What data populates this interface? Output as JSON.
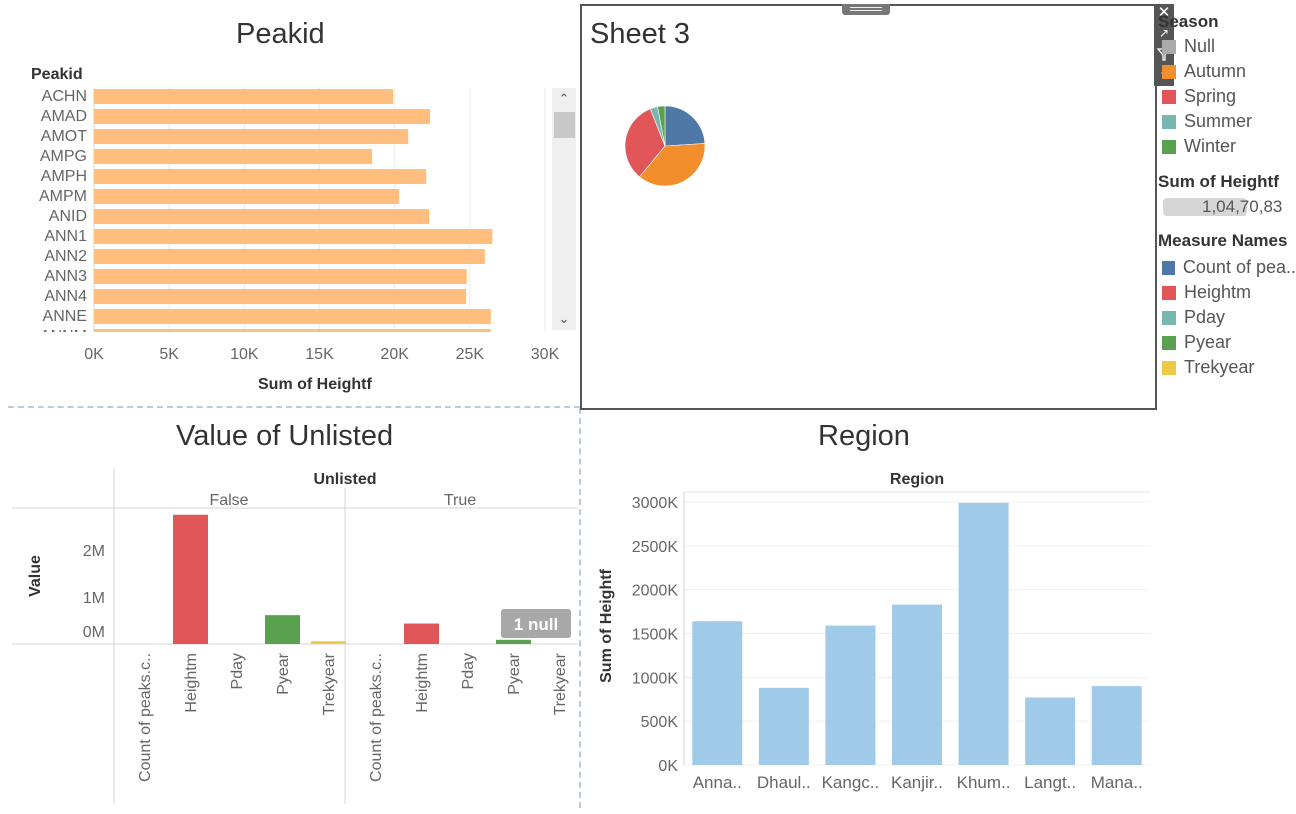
{
  "sheets": {
    "peakid": {
      "title": "Peakid"
    },
    "sheet3": {
      "title": "Sheet 3"
    },
    "unlisted": {
      "title": "Value of Unlisted"
    },
    "region": {
      "title": "Region"
    }
  },
  "legends": {
    "season": {
      "title": "Season",
      "items": [
        {
          "label": "Null",
          "color": "#aaaaaa"
        },
        {
          "label": "Autumn",
          "color": "#f28e2b"
        },
        {
          "label": "Spring",
          "color": "#e15759"
        },
        {
          "label": "Summer",
          "color": "#76b7b2"
        },
        {
          "label": "Winter",
          "color": "#59a14f"
        }
      ]
    },
    "size": {
      "title": "Sum of Heightf",
      "value": "1,04,70,83"
    },
    "measures": {
      "title": "Measure Names",
      "items": [
        {
          "label": "Count of pea..",
          "color": "#4e79a7"
        },
        {
          "label": "Heightm",
          "color": "#e15759"
        },
        {
          "label": "Pday",
          "color": "#76b7b2"
        },
        {
          "label": "Pyear",
          "color": "#59a14f"
        },
        {
          "label": "Trekyear",
          "color": "#edc948"
        }
      ]
    }
  },
  "null_badge": "1 null",
  "chart_data": [
    {
      "type": "bar",
      "orientation": "horizontal",
      "title": "Peakid",
      "row_header": "Peakid",
      "xlabel": "Sum of Heightf",
      "categories": [
        "ACHN",
        "AMAD",
        "AMOT",
        "AMPG",
        "AMPH",
        "AMPM",
        "ANID",
        "ANN1",
        "ANN2",
        "ANN3",
        "ANN4",
        "ANNE"
      ],
      "values": [
        19900,
        22350,
        20900,
        18500,
        22100,
        20300,
        22300,
        26500,
        26000,
        24800,
        24750,
        26400
      ],
      "xlim": [
        0,
        30000
      ],
      "xticks": [
        "0K",
        "5K",
        "10K",
        "15K",
        "20K",
        "25K",
        "30K"
      ],
      "color": "#ffbe7d"
    },
    {
      "type": "pie",
      "title": "Sheet 3",
      "slices": [
        {
          "label": "Count of pea..",
          "value": 24,
          "color": "#4e79a7"
        },
        {
          "label": "Autumn",
          "value": 37,
          "color": "#f28e2b"
        },
        {
          "label": "Spring",
          "value": 33,
          "color": "#e15759"
        },
        {
          "label": "Summer",
          "value": 3,
          "color": "#76b7b2"
        },
        {
          "label": "Winter",
          "value": 3,
          "color": "#59a14f"
        }
      ]
    },
    {
      "type": "bar",
      "title": "Value of Unlisted",
      "column_header": "Unlisted",
      "ylabel": "Value",
      "panels": [
        {
          "name": "False",
          "categories": [
            "Count of peaks.c..",
            "Heightm",
            "Pday",
            "Pyear",
            "Trekyear"
          ],
          "values": [
            0,
            2780000,
            0,
            620000,
            60000
          ]
        },
        {
          "name": "True",
          "categories": [
            "Count of peaks.c..",
            "Heightm",
            "Pday",
            "Pyear",
            "Trekyear"
          ],
          "values": [
            0,
            440000,
            0,
            90000,
            0
          ]
        }
      ],
      "colors": [
        "#4e79a7",
        "#e15759",
        "#76b7b2",
        "#59a14f",
        "#edc948"
      ],
      "yticks": [
        "2M",
        "1M",
        "0M"
      ],
      "ylim": [
        0,
        2900000
      ]
    },
    {
      "type": "bar",
      "title": "Region",
      "column_header": "Region",
      "ylabel": "Sum of Heightf",
      "categories": [
        "Anna..",
        "Dhaul..",
        "Kangc..",
        "Kanjir..",
        "Khum..",
        "Langt..",
        "Mana.."
      ],
      "values": [
        1640000,
        880000,
        1590000,
        1830000,
        2990000,
        770000,
        900000
      ],
      "ylim": [
        0,
        3000000
      ],
      "yticks": [
        "3000K",
        "2500K",
        "2000K",
        "1500K",
        "1000K",
        "500K",
        "0K"
      ],
      "color": "#a0cbe8"
    }
  ]
}
